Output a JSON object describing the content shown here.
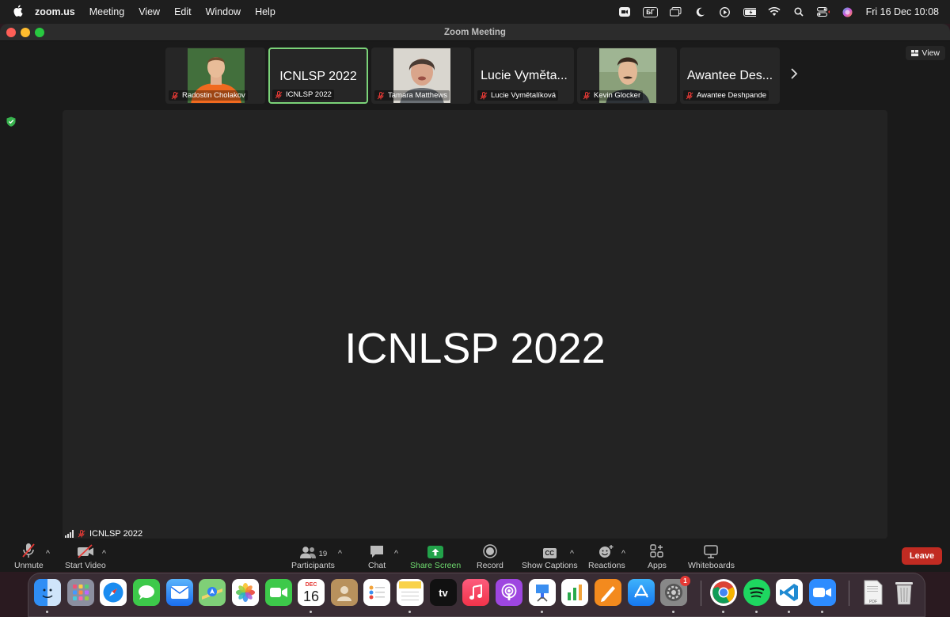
{
  "menubar": {
    "app_name": "zoom.us",
    "menus": [
      "Meeting",
      "View",
      "Edit",
      "Window",
      "Help"
    ],
    "keyboard_layout": "БГ",
    "clock": "Fri 16 Dec  10:08"
  },
  "window": {
    "title": "Zoom Meeting"
  },
  "view_button": "View",
  "thumbnails": [
    {
      "name": "Radostin Cholakov",
      "display": "",
      "has_video": true
    },
    {
      "name": "ICNLSP 2022",
      "display": "ICNLSP 2022",
      "has_video": false,
      "active": true
    },
    {
      "name": "Tamara Matthews",
      "display": "",
      "has_video": true
    },
    {
      "name": "Lucie Vymětalíková",
      "display": "Lucie Vymĕta...",
      "has_video": false
    },
    {
      "name": "Kevin Glocker",
      "display": "",
      "has_video": true
    },
    {
      "name": "Awantee Deshpande",
      "display": "Awantee Des...",
      "has_video": false
    }
  ],
  "stage": {
    "title": "ICNLSP 2022",
    "label": "ICNLSP 2022"
  },
  "toolbar": {
    "unmute": "Unmute",
    "start_video": "Start Video",
    "participants": "Participants",
    "participants_count": "19",
    "chat": "Chat",
    "share_screen": "Share Screen",
    "record": "Record",
    "show_captions": "Show Captions",
    "captions_icon_text": "CC",
    "reactions": "Reactions",
    "apps": "Apps",
    "whiteboards": "Whiteboards",
    "leave": "Leave"
  },
  "dock": {
    "calendar_month": "DEC",
    "calendar_day": "16",
    "appletv_text": "tv",
    "settings_badge": "1",
    "pdf_text": "PDF"
  },
  "colors": {
    "accent_green": "#7bd379",
    "leave_red": "#c12b22",
    "share_green": "#22a24a"
  }
}
